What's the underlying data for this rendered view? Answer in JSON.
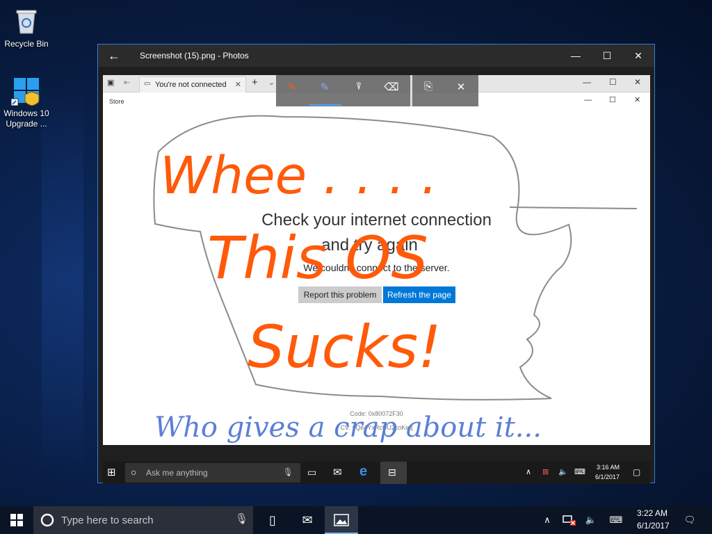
{
  "desktop": {
    "icons": [
      {
        "label": "Recycle Bin"
      },
      {
        "label_line1": "Windows 10",
        "label_line2": "Upgrade ..."
      }
    ]
  },
  "photos_window": {
    "title": "Screenshot (15).png - Photos",
    "buttons": {
      "back": "←",
      "minimize": "—",
      "maximize": "☐",
      "close": "✕"
    }
  },
  "screenshot": {
    "browser_tab": "You're not connected",
    "store_title": "Store",
    "heading_line1": "Check your internet connection",
    "heading_line2": "and try again",
    "subtext": "We couldn't connect to the server.",
    "report_button": "Report this problem",
    "refresh_button": "Refresh the page",
    "code": "Code: 0x80072F30",
    "cv": "CV: yQe4YxRcUU2coKeq",
    "inner_taskbar": {
      "search_placeholder": "Ask me anything",
      "time": "3:16 AM",
      "date": "6/1/2017"
    }
  },
  "ink_annotations": {
    "orange_text": [
      "Whee . . . .",
      "This OS",
      "Sucks!"
    ],
    "blue_text": "Who gives a crap about it...",
    "orange_color": "#ff5a0a",
    "blue_color": "#5b7fd6"
  },
  "taskbar": {
    "search_placeholder": "Type here to search",
    "time": "3:22 AM",
    "date": "6/1/2017"
  }
}
